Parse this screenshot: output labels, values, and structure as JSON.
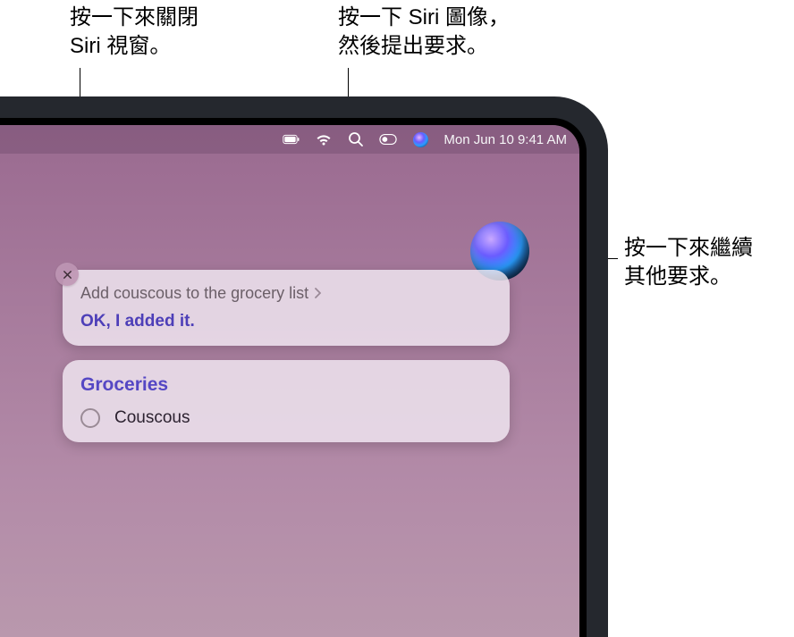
{
  "callouts": {
    "close": "按一下來關閉\nSiri 視窗。",
    "siri_menubar": "按一下 Siri 圖像，\n然後提出要求。",
    "siri_orb": "按一下來繼續\n其他要求。"
  },
  "menubar": {
    "date": "Mon Jun 10  9:41 AM"
  },
  "siri": {
    "request": "Add couscous to the grocery list",
    "response": "OK, I added it.",
    "list_title": "Groceries",
    "list_item": "Couscous"
  }
}
